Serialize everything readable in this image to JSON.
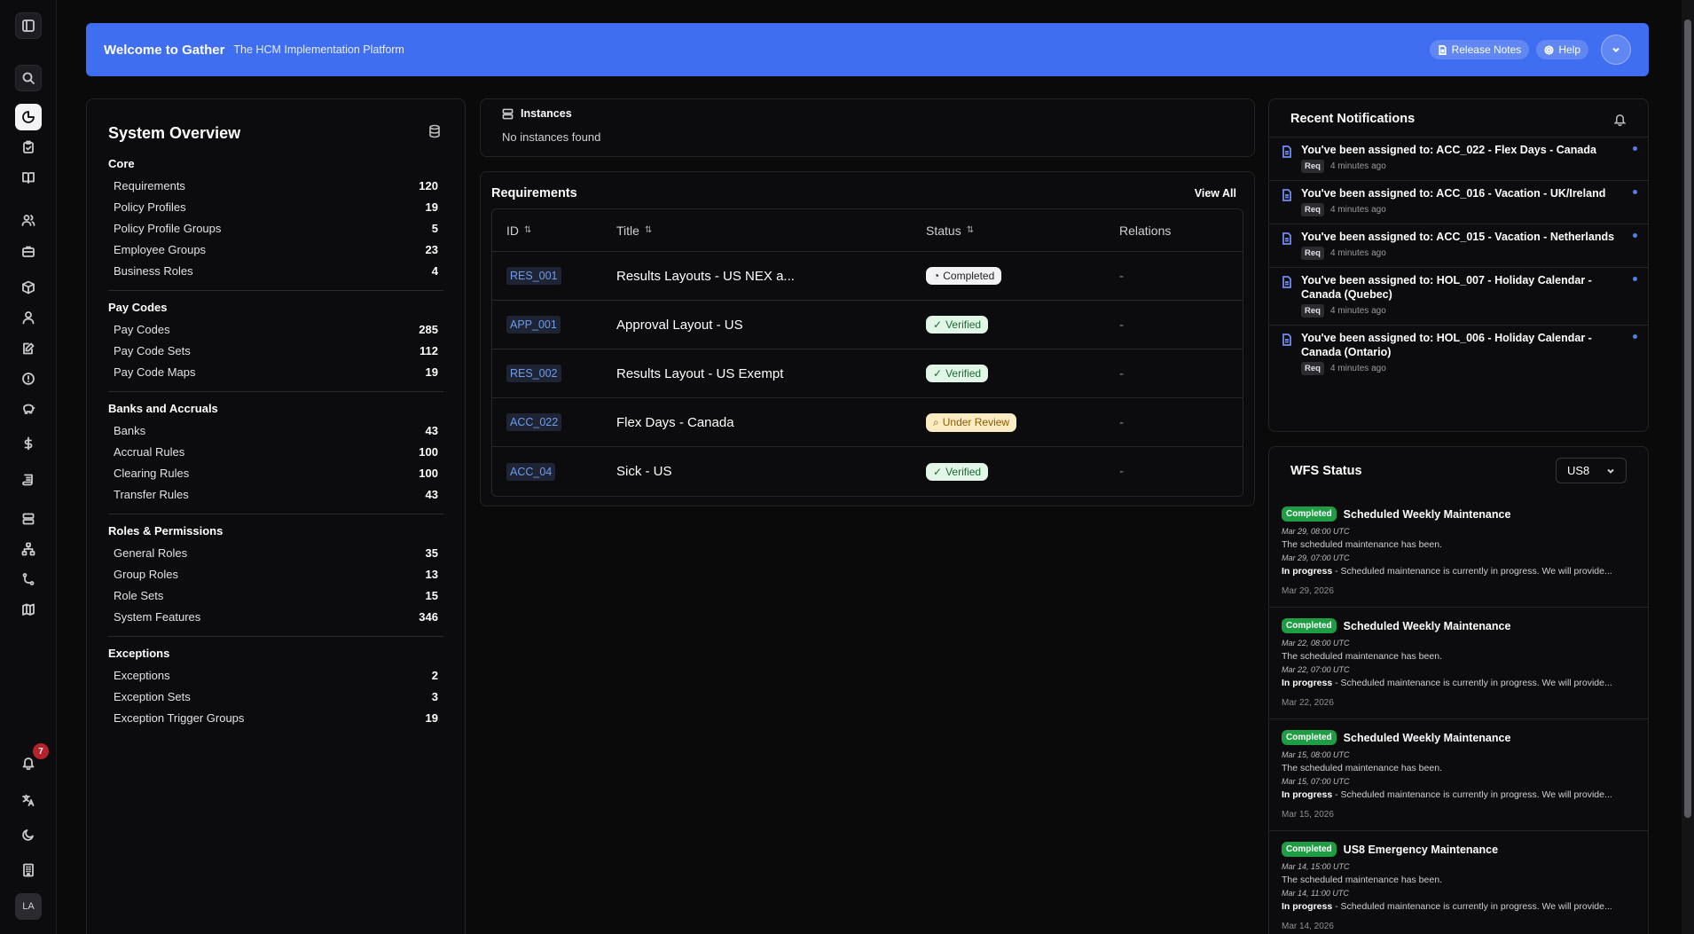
{
  "header": {
    "title": "Welcome to Gather",
    "subtitle": "The HCM Implementation Platform",
    "release_notes": "Release Notes",
    "help": "Help"
  },
  "sidebar": {
    "notification_count": "7",
    "user_initials": "LA"
  },
  "overview": {
    "title": "System Overview",
    "groups": [
      {
        "title": "Core",
        "items": [
          {
            "label": "Requirements",
            "count": "120"
          },
          {
            "label": "Policy Profiles",
            "count": "19"
          },
          {
            "label": "Policy Profile Groups",
            "count": "5"
          },
          {
            "label": "Employee Groups",
            "count": "23"
          },
          {
            "label": "Business Roles",
            "count": "4"
          }
        ]
      },
      {
        "title": "Pay Codes",
        "items": [
          {
            "label": "Pay Codes",
            "count": "285"
          },
          {
            "label": "Pay Code Sets",
            "count": "112"
          },
          {
            "label": "Pay Code Maps",
            "count": "19"
          }
        ]
      },
      {
        "title": "Banks and Accruals",
        "items": [
          {
            "label": "Banks",
            "count": "43"
          },
          {
            "label": "Accrual Rules",
            "count": "100"
          },
          {
            "label": "Clearing Rules",
            "count": "100"
          },
          {
            "label": "Transfer Rules",
            "count": "43"
          }
        ]
      },
      {
        "title": "Roles & Permissions",
        "items": [
          {
            "label": "General Roles",
            "count": "35"
          },
          {
            "label": "Group Roles",
            "count": "13"
          },
          {
            "label": "Role Sets",
            "count": "15"
          },
          {
            "label": "System Features",
            "count": "346"
          }
        ]
      },
      {
        "title": "Exceptions",
        "items": [
          {
            "label": "Exceptions",
            "count": "2"
          },
          {
            "label": "Exception Sets",
            "count": "3"
          },
          {
            "label": "Exception Trigger Groups",
            "count": "19"
          }
        ]
      }
    ]
  },
  "instances": {
    "title": "Instances",
    "empty": "No instances found"
  },
  "requirements": {
    "title": "Requirements",
    "view_all": "View All",
    "columns": {
      "id": "ID",
      "title": "Title",
      "status": "Status",
      "relations": "Relations"
    },
    "rows": [
      {
        "id": "RES_001",
        "title": "Results Layouts - US NEX a...",
        "status": "Completed",
        "relations": "-"
      },
      {
        "id": "APP_001",
        "title": "Approval Layout - US",
        "status": "Verified",
        "relations": "-"
      },
      {
        "id": "RES_002",
        "title": "Results Layout - US Exempt",
        "status": "Verified",
        "relations": "-"
      },
      {
        "id": "ACC_022",
        "title": "Flex Days - Canada",
        "status": "Under Review",
        "relations": "-"
      },
      {
        "id": "ACC_04",
        "title": "Sick - US",
        "status": "Verified",
        "relations": "-"
      }
    ]
  },
  "notifications": {
    "title": "Recent Notifications",
    "items": [
      {
        "text": "You've been assigned to: ACC_022 - Flex Days - Canada",
        "tag": "Req",
        "time": "4 minutes ago"
      },
      {
        "text": "You've been assigned to: ACC_016 - Vacation - UK/Ireland",
        "tag": "Req",
        "time": "4 minutes ago"
      },
      {
        "text": "You've been assigned to: ACC_015 - Vacation - Netherlands",
        "tag": "Req",
        "time": "4 minutes ago"
      },
      {
        "text": "You've been assigned to: HOL_007 - Holiday Calendar - Canada (Quebec)",
        "tag": "Req",
        "time": "4 minutes ago"
      },
      {
        "text": "You've been assigned to: HOL_006 - Holiday Calendar - Canada (Ontario)",
        "tag": "Req",
        "time": "4 minutes ago"
      }
    ]
  },
  "wfs": {
    "title": "WFS Status",
    "selected": "US8",
    "items": [
      {
        "badge": "Completed",
        "title": "Scheduled Weekly Maintenance",
        "ts1": "Mar 29, 08:00 UTC",
        "line1": "The scheduled maintenance has been.",
        "ts2": "Mar 29, 07:00 UTC",
        "line2_label": "In progress",
        "line2": " - Scheduled maintenance is currently in progress. We will provide...",
        "date": "Mar 29, 2026"
      },
      {
        "badge": "Completed",
        "title": "Scheduled Weekly Maintenance",
        "ts1": "Mar 22, 08:00 UTC",
        "line1": "The scheduled maintenance has been.",
        "ts2": "Mar 22, 07:00 UTC",
        "line2_label": "In progress",
        "line2": " - Scheduled maintenance is currently in progress. We will provide...",
        "date": "Mar 22, 2026"
      },
      {
        "badge": "Completed",
        "title": "Scheduled Weekly Maintenance",
        "ts1": "Mar 15, 08:00 UTC",
        "line1": "The scheduled maintenance has been.",
        "ts2": "Mar 15, 07:00 UTC",
        "line2_label": "In progress",
        "line2": " - Scheduled maintenance is currently in progress. We will provide...",
        "date": "Mar 15, 2026"
      },
      {
        "badge": "Completed",
        "title": "US8 Emergency Maintenance",
        "ts1": "Mar 14, 15:00 UTC",
        "line1": "The scheduled maintenance has been.",
        "ts2": "Mar 14, 11:00 UTC",
        "line2_label": "In progress",
        "line2": " - Scheduled maintenance is currently in progress. We will provide...",
        "date": "Mar 14, 2026"
      }
    ]
  }
}
